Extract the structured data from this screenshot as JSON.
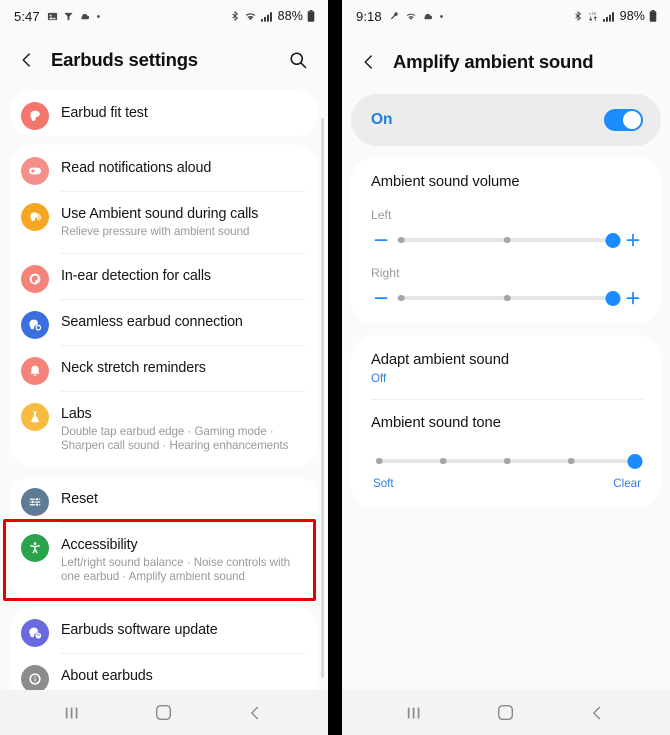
{
  "left_phone": {
    "status_bar": {
      "time": "5:47",
      "left_icons": [
        "image-icon",
        "filter-icon",
        "cloud-icon",
        "dot-icon"
      ],
      "right_icons": [
        "bluetooth-icon",
        "wifi-icon",
        "signal-icon"
      ],
      "battery": "88%"
    },
    "app_bar": {
      "back": "back-icon",
      "title": "Earbuds settings",
      "search": "search-icon"
    },
    "groups": [
      {
        "items": [
          {
            "title": "Earbud fit test",
            "sub": "",
            "icon": "earbud-fit-icon",
            "color": "#f2766b"
          }
        ]
      },
      {
        "items": [
          {
            "title": "Read notifications aloud",
            "sub": "",
            "icon": "notification-read-icon",
            "color": "#f49089"
          },
          {
            "title": "Use Ambient sound during calls",
            "sub": "Relieve pressure with ambient sound",
            "icon": "ambient-call-icon",
            "color": "#f5a623"
          },
          {
            "title": "In-ear detection for calls",
            "sub": "",
            "icon": "in-ear-icon",
            "color": "#f4837a"
          },
          {
            "title": "Seamless earbud connection",
            "sub": "",
            "icon": "seamless-connect-icon",
            "color": "#3b6fe0"
          },
          {
            "title": "Neck stretch reminders",
            "sub": "",
            "icon": "bell-icon",
            "color": "#f4837a"
          },
          {
            "title": "Labs",
            "sub": "Double tap earbud edge  ·  Gaming mode  ·  Sharpen call sound  ·  Hearing enhancements",
            "icon": "flask-icon",
            "color": "#f6bb3f"
          }
        ]
      },
      {
        "items": [
          {
            "title": "Reset",
            "sub": "",
            "icon": "reset-sliders-icon",
            "color": "#5e7b96"
          },
          {
            "title": "Accessibility",
            "sub": "Left/right sound balance  ·  Noise controls with one earbud  ·  Amplify ambient sound",
            "icon": "accessibility-icon",
            "color": "#2ba24c"
          }
        ]
      },
      {
        "items": [
          {
            "title": "Earbuds software update",
            "sub": "",
            "icon": "software-update-icon",
            "color": "#6a6ae0"
          },
          {
            "title": "About earbuds",
            "sub": "",
            "icon": "info-icon",
            "color": "#8c8c8c"
          }
        ]
      }
    ],
    "highlight_color": "#e60000",
    "nav_bar": [
      "recents-icon",
      "home-icon",
      "back-icon"
    ]
  },
  "right_phone": {
    "status_bar": {
      "time": "9:18",
      "left_icons": [
        "wrench-icon",
        "wifi-icon",
        "cloud-icon",
        "dot-icon"
      ],
      "right_icons": [
        "bluetooth-icon",
        "lte-icon",
        "signal-icon"
      ],
      "battery": "98%"
    },
    "app_bar": {
      "back": "back-icon",
      "title": "Amplify ambient sound"
    },
    "master_toggle": {
      "label": "On",
      "state": "on",
      "accent": "#1a8cff"
    },
    "volume_section": {
      "title": "Ambient sound volume",
      "channels": [
        {
          "label": "Left",
          "stops": 3,
          "value": 3,
          "minus": "minus-icon",
          "plus": "plus-icon"
        },
        {
          "label": "Right",
          "stops": 3,
          "value": 3,
          "minus": "minus-icon",
          "plus": "plus-icon"
        }
      ]
    },
    "adapt_section": {
      "title": "Adapt ambient sound",
      "value": "Off"
    },
    "tone_section": {
      "title": "Ambient sound tone",
      "stops": 5,
      "value": 5,
      "min_label": "Soft",
      "max_label": "Clear"
    },
    "nav_bar": [
      "recents-icon",
      "home-icon",
      "back-icon"
    ]
  }
}
